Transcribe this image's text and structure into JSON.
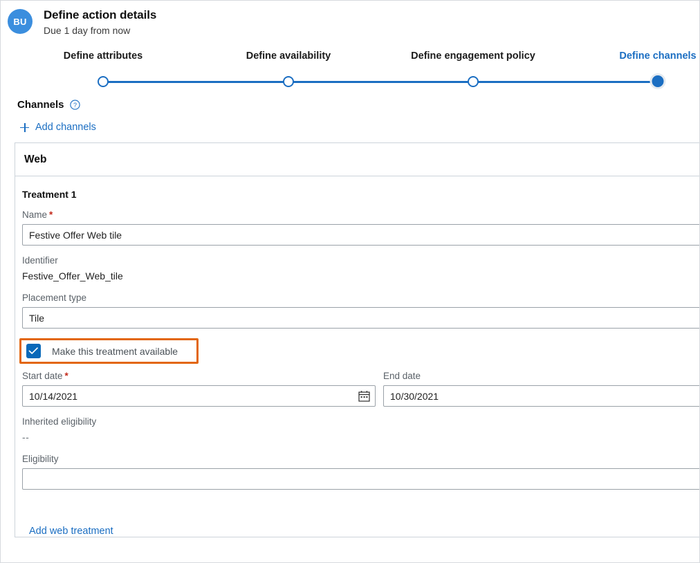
{
  "header": {
    "avatar_initials": "BU",
    "title": "Define action details",
    "subtitle": "Due 1 day from now"
  },
  "stepper": {
    "steps": [
      {
        "label": "Define attributes",
        "state": "incomplete"
      },
      {
        "label": "Define availability",
        "state": "incomplete"
      },
      {
        "label": "Define engagement policy",
        "state": "incomplete"
      },
      {
        "label": "Define channels",
        "state": "current"
      }
    ],
    "accent_color": "#1b6ec2"
  },
  "channels_section": {
    "title": "Channels",
    "help_icon": "question-circle-icon",
    "add_channels_label": "Add channels",
    "add_icon": "plus-icon"
  },
  "channel": {
    "name": "Web",
    "treatment": {
      "title": "Treatment 1",
      "name_label": "Name",
      "name_required": "*",
      "name_value": "Festive Offer Web tile",
      "identifier_label": "Identifier",
      "identifier_value": "Festive_Offer_Web_tile",
      "placement_label": "Placement type",
      "placement_value": "Tile",
      "available_checkbox_label": "Make this treatment available",
      "available_checked": true,
      "highlight_color": "#e2660d",
      "start_date_label": "Start date",
      "start_date_required": "*",
      "start_date_value": "10/14/2021",
      "calendar_icon": "calendar-icon",
      "end_date_label": "End date",
      "end_date_value": "10/30/2021",
      "inherited_eligibility_label": "Inherited eligibility",
      "inherited_eligibility_value": "--",
      "eligibility_label": "Eligibility",
      "eligibility_value": ""
    },
    "add_treatment_label": "Add web treatment"
  }
}
